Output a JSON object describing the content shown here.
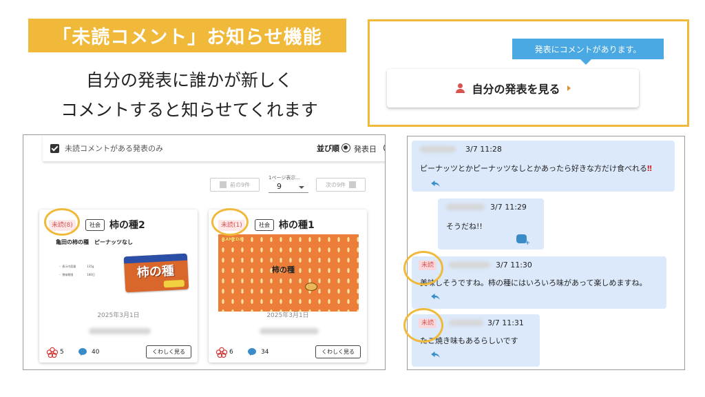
{
  "header": {
    "banner": "「未読コメント」お知らせ機能",
    "subtitle_line1": "自分の発表に誰かが新しく",
    "subtitle_line2": "コメントすると知らせてくれます"
  },
  "notification": {
    "tooltip": "発表にコメントがあります。",
    "button_label": "自分の発表を見る",
    "icon": "person-icon"
  },
  "list_view": {
    "filter_label": "未読コメントがある発表のみ",
    "filter_checked": true,
    "sort_label": "並び順",
    "sort_options": [
      "発表日",
      "発"
    ],
    "sort_selected": "発表日",
    "pager": {
      "prev_label": "前の9件",
      "next_label": "次の9件",
      "per_page_label": "1ページ表示...",
      "per_page_value": "9"
    },
    "cards": [
      {
        "unread_label": "未読(8)",
        "genre": "社会",
        "title": "柿の種2",
        "thumb_heading": "亀田の柿の種　ピーナッツなし",
        "thumb_lines": [
          "・ 表示内容量　　　　135g",
          "・ 賞味期限　　　　　180日"
        ],
        "bag_text": "柿の種",
        "date": "2025年3月1日",
        "flower_count": "5",
        "comment_count": "40",
        "detail_label": "くわしく見る"
      },
      {
        "unread_label": "未読(1)",
        "genre": "社会",
        "title": "柿の種1",
        "thumb_center": "柿の種",
        "date": "2025年3月1日",
        "flower_count": "6",
        "comment_count": "34",
        "detail_label": "くわしく見る"
      }
    ]
  },
  "comments": [
    {
      "unread": "",
      "time": "3/7 11:28",
      "text": "ピーナッツとかピーナッツなしとかあったら好きな方だけ食べれる",
      "emphasis": "‼"
    },
    {
      "unread": "",
      "time": "3/7 11:29",
      "text": "そうだね!!"
    },
    {
      "unread": "未読",
      "time": "3/7 11:30",
      "text": "美味しそうですね。柿の種にはいろいろ味があって楽しめますね。"
    },
    {
      "unread": "未読",
      "time": "3/7 11:31",
      "text": "たこ焼き味もあるらしいです"
    }
  ],
  "colors": {
    "accent": "#f0b93a",
    "tooltip": "#4aa8e2",
    "bubble": "#dbe9fb",
    "unread_bg": "#fde7e7",
    "unread_text": "#d85555",
    "person_icon": "#d9534f"
  }
}
